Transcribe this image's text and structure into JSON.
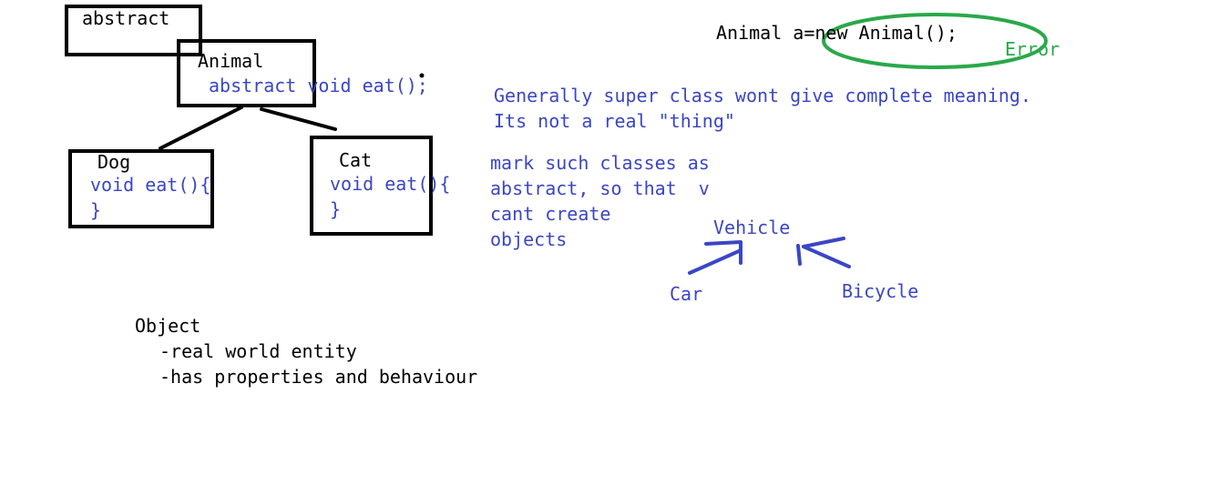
{
  "colors": {
    "ink_black": "#000000",
    "ink_blue": "#3b46c4",
    "ink_green": "#2aa84a",
    "background": "#ffffff"
  },
  "hierarchy": {
    "abstract_tag": "abstract",
    "parent": {
      "name": "Animal",
      "method": "abstract void eat();"
    },
    "children": [
      {
        "name": "Dog",
        "method_open": "void eat(){",
        "method_close": "}"
      },
      {
        "name": "Cat",
        "method_open": "void eat(){",
        "method_close": "}"
      }
    ]
  },
  "instantiation": {
    "code": "Animal a=new Animal();",
    "result": "Error"
  },
  "note": {
    "lines": [
      "Generally super class wont give complete meaning.",
      "Its not a real \"thing\""
    ]
  },
  "advice": {
    "lines": [
      "mark such classes as",
      "abstract, so that  v",
      "cant create",
      "objects"
    ]
  },
  "vehicle_example": {
    "parent": "Vehicle",
    "children": [
      "Car",
      "Bicycle"
    ]
  },
  "object_definition": {
    "title": "Object",
    "points": [
      "-real world entity",
      "-has properties and behaviour"
    ]
  }
}
